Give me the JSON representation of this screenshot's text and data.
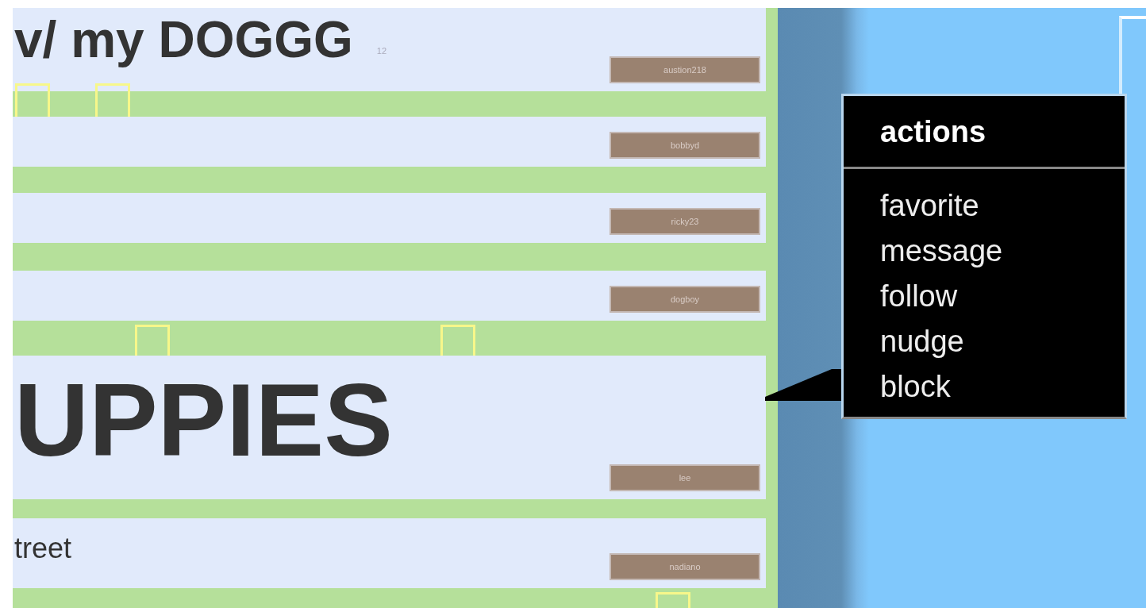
{
  "posts": [
    {
      "kind": "headline",
      "title": "v/ my DOGGG",
      "meta": "12",
      "author": "austion218"
    },
    {
      "kind": "empty",
      "author": "bobbyd"
    },
    {
      "kind": "empty",
      "author": "ricky23"
    },
    {
      "kind": "empty",
      "author": "dogboy"
    },
    {
      "kind": "hero",
      "title": "UPPIES",
      "author": "lee"
    },
    {
      "kind": "caption",
      "title": "treet",
      "author": "nadiano"
    }
  ],
  "actions_menu": {
    "title": "actions",
    "items": [
      "favorite",
      "message",
      "follow",
      "nudge",
      "block"
    ]
  }
}
